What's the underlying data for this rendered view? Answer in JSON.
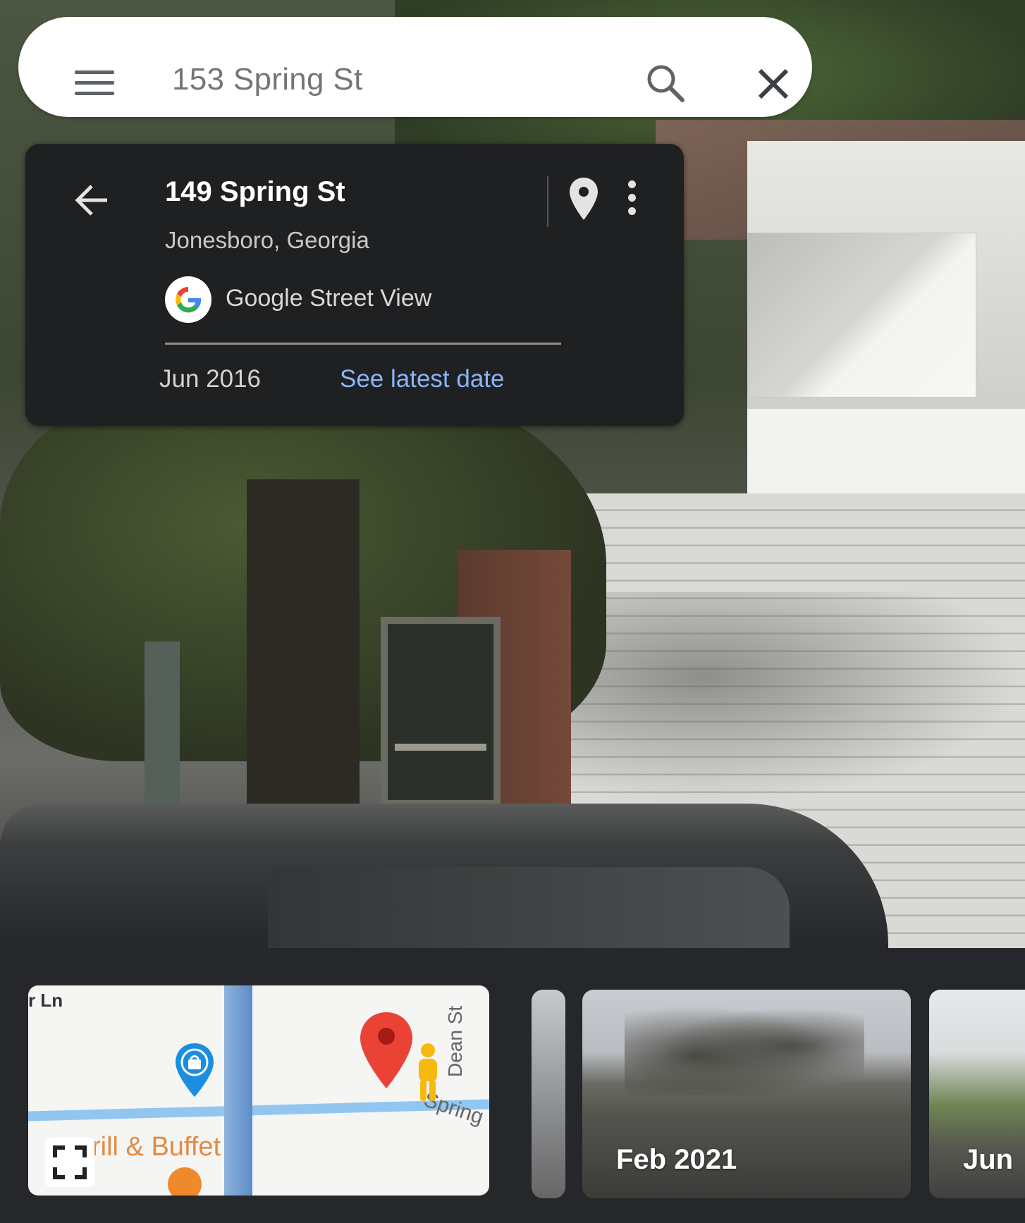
{
  "search": {
    "query": "153 Spring St"
  },
  "card": {
    "title": "149 Spring St",
    "subtitle": "Jonesboro, Georgia",
    "source": "Google Street View",
    "date": "Jun 2016",
    "latest_link": "See latest date"
  },
  "minimap": {
    "labels": {
      "lane": "r Ln",
      "dean": "Dean St",
      "spring": "Spring",
      "grill": "rill & Buffet"
    }
  },
  "timeline": {
    "thumbs": [
      {
        "label": ""
      },
      {
        "label": "Feb 2021"
      },
      {
        "label": "Jun"
      }
    ]
  },
  "colors": {
    "link": "#8ab4f8",
    "card_bg": "#1f2022",
    "pin": "#ea4335"
  }
}
